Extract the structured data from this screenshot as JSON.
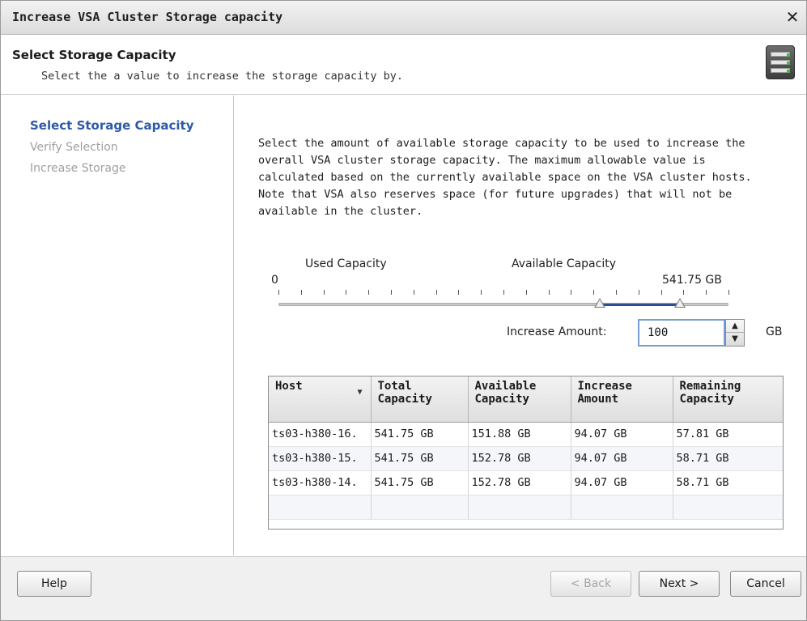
{
  "window": {
    "title": "Increase VSA Cluster Storage capacity",
    "close_glyph": "✕"
  },
  "header": {
    "title": "Select Storage Capacity",
    "subtitle": "Select the a value to increase the storage capacity by.",
    "icon": "server-icon"
  },
  "nav": {
    "steps": [
      {
        "label": "Select Storage Capacity",
        "active": true
      },
      {
        "label": "Verify Selection",
        "active": false
      },
      {
        "label": "Increase Storage",
        "active": false
      }
    ]
  },
  "main": {
    "description": "Select the amount of available storage capacity to be used to increase the overall VSA cluster storage capacity. The maximum allowable value is calculated based on the currently available space on the VSA cluster hosts. Note that VSA also reserves space (for future upgrades) that will not be available in the cluster.",
    "slider": {
      "used_label": "Used Capacity",
      "available_label": "Available Capacity",
      "min_label": "0",
      "max_label": "541.75 GB"
    },
    "increase": {
      "label": "Increase Amount:",
      "value": "100",
      "unit": "GB"
    },
    "table": {
      "columns": [
        "Host",
        "Total Capacity",
        "Available Capacity",
        "Increase Amount",
        "Remaining Capacity"
      ],
      "rows": [
        [
          "ts03-h380-16.",
          "541.75 GB",
          "151.88 GB",
          "94.07 GB",
          "57.81 GB"
        ],
        [
          "ts03-h380-15.",
          "541.75 GB",
          "152.78 GB",
          "94.07 GB",
          "58.71 GB"
        ],
        [
          "ts03-h380-14.",
          "541.75 GB",
          "152.78 GB",
          "94.07 GB",
          "58.71 GB"
        ]
      ]
    }
  },
  "footer": {
    "help": "Help",
    "back": "< Back",
    "next": "Next >",
    "cancel": "Cancel"
  }
}
